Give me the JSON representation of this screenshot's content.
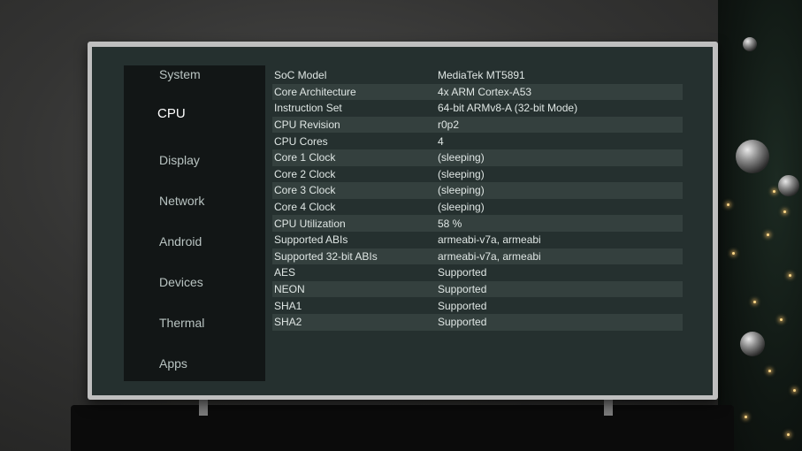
{
  "sidebar": {
    "items": [
      {
        "label": "System",
        "active": false
      },
      {
        "label": "CPU",
        "active": true
      },
      {
        "label": "Display",
        "active": false
      },
      {
        "label": "Network",
        "active": false
      },
      {
        "label": "Android",
        "active": false
      },
      {
        "label": "Devices",
        "active": false
      },
      {
        "label": "Thermal",
        "active": false
      },
      {
        "label": "Apps",
        "active": false
      }
    ]
  },
  "cpu_table": {
    "rows": [
      {
        "key": "SoC Model",
        "value": "MediaTek MT5891"
      },
      {
        "key": "Core Architecture",
        "value": "4x ARM Cortex-A53"
      },
      {
        "key": "Instruction Set",
        "value": "64-bit ARMv8-A (32-bit Mode)"
      },
      {
        "key": "CPU Revision",
        "value": "r0p2"
      },
      {
        "key": "CPU Cores",
        "value": "4"
      },
      {
        "key": "Core 1 Clock",
        "value": "(sleeping)"
      },
      {
        "key": "Core 2 Clock",
        "value": "(sleeping)"
      },
      {
        "key": "Core 3 Clock",
        "value": "(sleeping)"
      },
      {
        "key": "Core 4 Clock",
        "value": "(sleeping)"
      },
      {
        "key": "CPU Utilization",
        "value": "58 %"
      },
      {
        "key": "Supported ABIs",
        "value": "armeabi-v7a, armeabi"
      },
      {
        "key": "Supported 32-bit ABIs",
        "value": "armeabi-v7a, armeabi"
      },
      {
        "key": "AES",
        "value": "Supported"
      },
      {
        "key": "NEON",
        "value": "Supported"
      },
      {
        "key": "SHA1",
        "value": "Supported"
      },
      {
        "key": "SHA2",
        "value": "Supported"
      }
    ]
  },
  "colors": {
    "screen_bg": "#25302f",
    "sidebar_bg": "#121616",
    "row_shade": "#34403e",
    "text": "#dfe6e4"
  }
}
